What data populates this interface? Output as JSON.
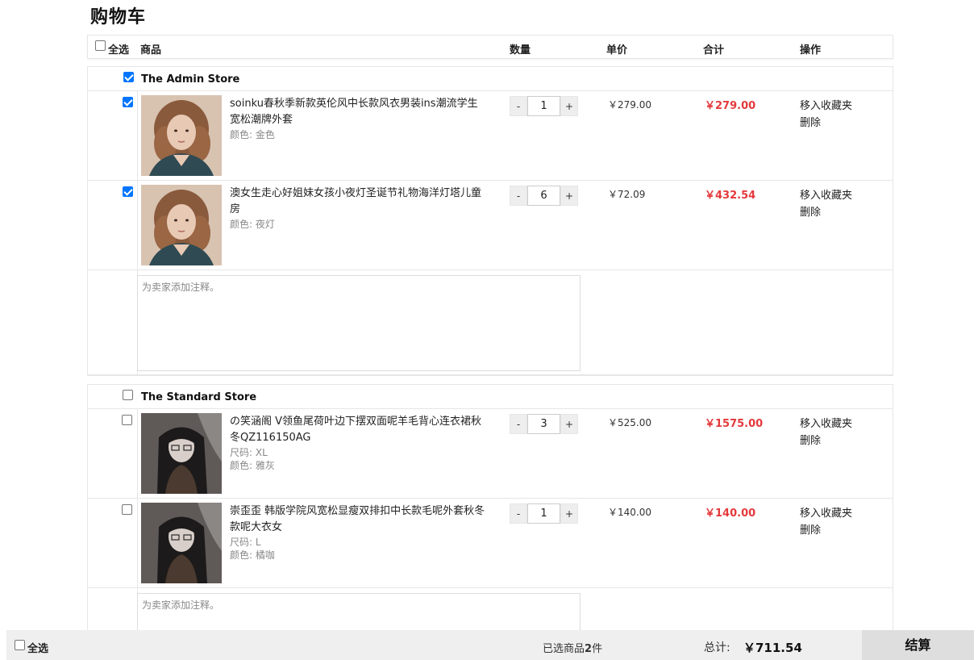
{
  "page": {
    "title": "购物车"
  },
  "header": {
    "select_all": "全选",
    "product": "商品",
    "quantity": "数量",
    "unit_price": "单价",
    "subtotal": "合计",
    "actions": "操作"
  },
  "stores": [
    {
      "name": "The Admin Store",
      "checked": true,
      "note_placeholder": "为卖家添加注释。",
      "items": [
        {
          "checked": true,
          "title": "soinku春秋季新款英伦风中长款风衣男装ins潮流学生宽松潮牌外套",
          "specs": [
            "颜色: 金色"
          ],
          "quantity": "1",
          "unit_price": "￥279.00",
          "total": "￥279.00",
          "actions": [
            "移入收藏夹",
            "删除"
          ],
          "image": "woman-brown-curly-hair"
        },
        {
          "checked": true,
          "title": "澳女生走心好姐妹女孩小夜灯圣诞节礼物海洋灯塔儿童房",
          "specs": [
            "颜色: 夜灯"
          ],
          "quantity": "6",
          "unit_price": "￥72.09",
          "total": "￥432.54",
          "actions": [
            "移入收藏夹",
            "删除"
          ],
          "image": "woman-brown-curly-hair"
        }
      ]
    },
    {
      "name": "The Standard Store",
      "checked": false,
      "note_placeholder": "为卖家添加注释。",
      "items": [
        {
          "checked": false,
          "title": "の笑涵阁 V领鱼尾荷叶边下摆双面呢羊毛背心连衣裙秋冬QZ116150AG",
          "specs": [
            "尺码: XL",
            "颜色: 雅灰"
          ],
          "quantity": "3",
          "unit_price": "￥525.00",
          "total": "￥1575.00",
          "actions": [
            "移入收藏夹",
            "删除"
          ],
          "image": "anime-girl-dark-hair"
        },
        {
          "checked": false,
          "title": "崇歪歪 韩版学院风宽松显瘦双排扣中长款毛呢外套秋冬款呢大衣女",
          "specs": [
            "尺码: L",
            "颜色: 橘咖"
          ],
          "quantity": "1",
          "unit_price": "￥140.00",
          "total": "￥140.00",
          "actions": [
            "移入收藏夹",
            "删除"
          ],
          "image": "anime-girl-dark-hair"
        }
      ]
    }
  ],
  "footer": {
    "select_all": "全选",
    "selected_prefix": "已选商品",
    "selected_count": "2",
    "selected_suffix": "件",
    "total_label": "总计:",
    "total_value": "￥711.54",
    "checkout": "结算"
  },
  "controls": {
    "minus": "-",
    "plus": "+"
  },
  "colors": {
    "accent_price": "#e4393c",
    "checkbox": "#0075ff",
    "footer_bg": "#efefef"
  }
}
